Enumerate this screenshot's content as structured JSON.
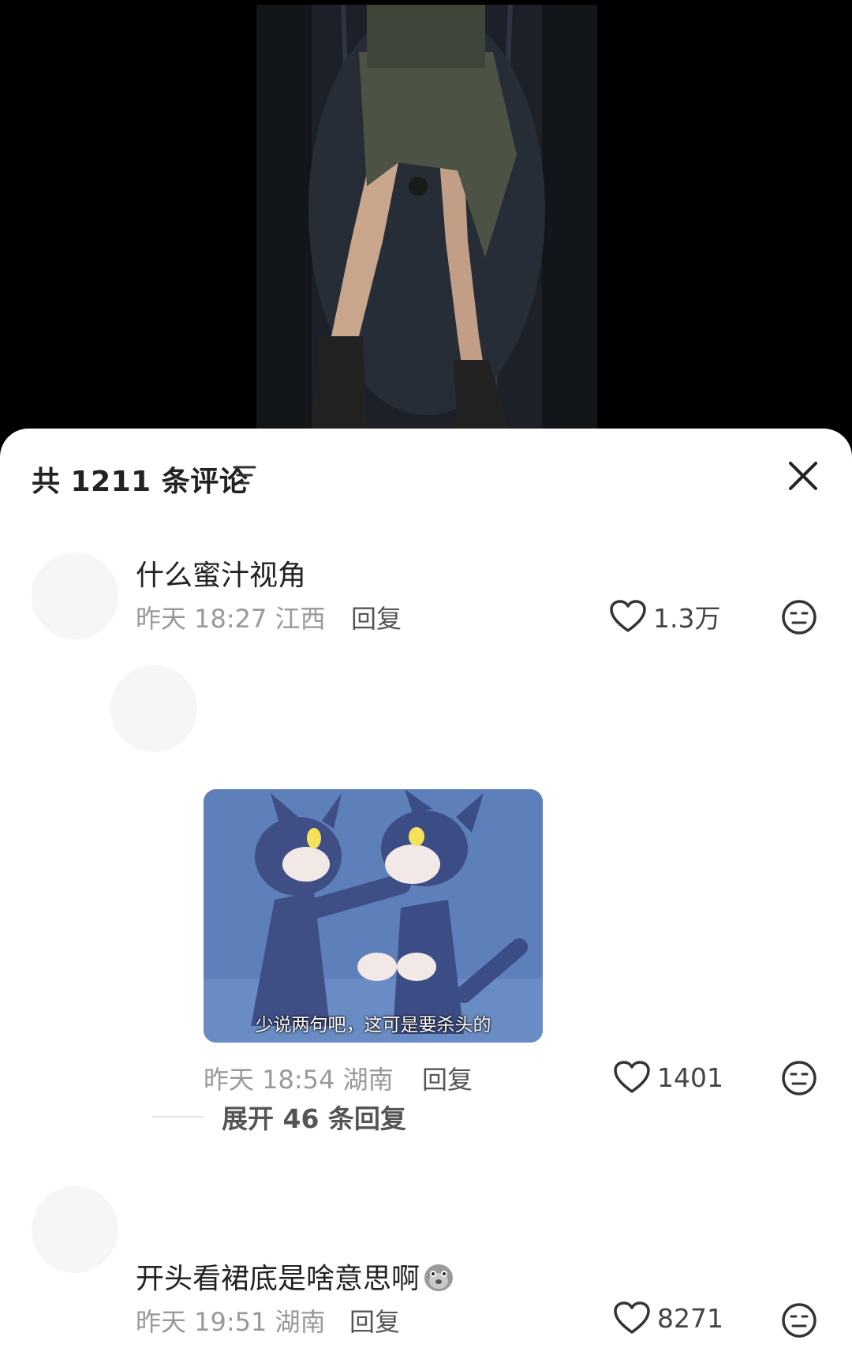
{
  "header": {
    "comment_count_label": "共 1211 条评论"
  },
  "comments": [
    {
      "text": "什么蜜汁视角",
      "date": "昨天 18:27 江西",
      "reply_label": "回复",
      "likes": "1.3万"
    },
    {
      "image_subtitle": "少说两句吧，这可是要杀头的",
      "date": "昨天 18:54 湖南",
      "reply_label": "回复",
      "likes": "1401",
      "expand_label": "展开 46 条回复"
    },
    {
      "text": "开头看裙底是啥意思啊",
      "date": "昨天 19:51 湖南",
      "reply_label": "回复",
      "likes": "8271"
    }
  ],
  "icons": {
    "sort": "sort-icon",
    "close": "close-icon",
    "like": "heart-icon",
    "emoji": "neutral-face-icon"
  }
}
